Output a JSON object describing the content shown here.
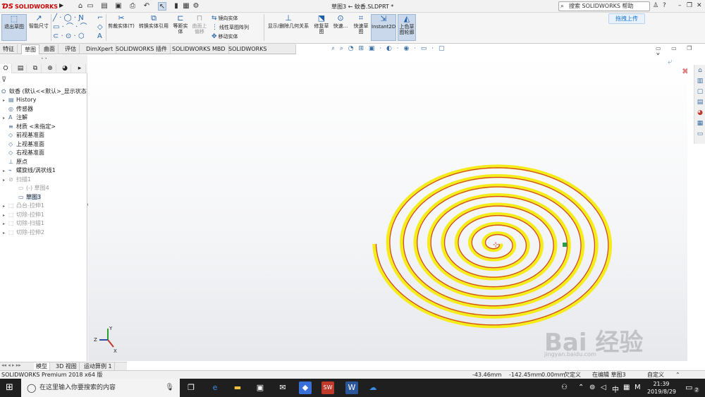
{
  "titlebar": {
    "brand": "SOLIDWORKS",
    "doc_title": "草图3 ← 蚊香.SLDPRT *",
    "search_placeholder": "搜索 SOLIDWORKS 帮助",
    "help": "?"
  },
  "ribbon": {
    "exit_sketch": "退出草图",
    "smart_dim": "智能尺寸",
    "trim": "剪裁实体(T)",
    "convert": "转换实体引用",
    "offset": "等距实体",
    "surface_offset": "曲面上偏移",
    "mirror": "镜向实体",
    "linear_pattern": "线性草图阵列",
    "move": "移动实体",
    "show_relations": "显示/删除几何关系",
    "repair": "修复草图",
    "quick_snaps": "快速...",
    "rapid_sketch": "快速草图",
    "instant2d": "Instant2D",
    "shaded_contours": "上色草图轮廓",
    "upload": "拖拽上传"
  },
  "tabs": [
    "特征",
    "草图",
    "曲面",
    "评估",
    "DimXpert",
    "SOLIDWORKS 插件",
    "SOLIDWORKS MBD",
    "SOLIDWORKS Inspection"
  ],
  "tabs_active": 1,
  "tree": {
    "root": "蚊香 (默认<<默认>_显示状态",
    "items": [
      {
        "label": "History",
        "dim": false
      },
      {
        "label": "传感器",
        "dim": false
      },
      {
        "label": "注解",
        "dim": false
      },
      {
        "label": "材质 <未指定>",
        "dim": false
      },
      {
        "label": "前视基准面",
        "dim": false
      },
      {
        "label": "上视基准面",
        "dim": false
      },
      {
        "label": "右视基准面",
        "dim": false
      },
      {
        "label": "原点",
        "dim": false
      },
      {
        "label": "螺旋线/涡状线1",
        "dim": false
      },
      {
        "label": "扫描1",
        "dim": true
      },
      {
        "label": "(-) 草图4",
        "dim": true
      },
      {
        "label": "草图3",
        "dim": false
      },
      {
        "label": "凸台-拉伸1",
        "dim": true
      },
      {
        "label": "切除-拉伸1",
        "dim": true
      },
      {
        "label": "切除-扫描1",
        "dim": true
      },
      {
        "label": "切除-拉伸2",
        "dim": true
      }
    ]
  },
  "triad": {
    "x": "X",
    "y": "Y",
    "z": "Z"
  },
  "bottom_tabs": [
    "模型",
    "3D 视图",
    "运动算例 1"
  ],
  "status": {
    "product": "SOLIDWORKS Premium 2018 x64 版",
    "x": "-43.46mm",
    "y": "-142.45mm",
    "z": "0.00mm",
    "state": "欠定义",
    "editing": "在编辑 草图3",
    "units": "自定义"
  },
  "taskbar": {
    "search": "在这里输入你要搜索的内容",
    "ime": "中",
    "time": "21:39",
    "date": "2019/8/29",
    "notif": "2"
  },
  "watermark": "Bai 经验",
  "watermark_sub": "jingyan.baidu.com",
  "colors": {
    "spiral_yellow": "#f5ec1a",
    "spiral_red": "#d2462d",
    "selection_blue": "#dbe8f7",
    "accent": "#1e5fa8"
  },
  "chart_data": {
    "type": "spiral",
    "turns": 8.5
  }
}
